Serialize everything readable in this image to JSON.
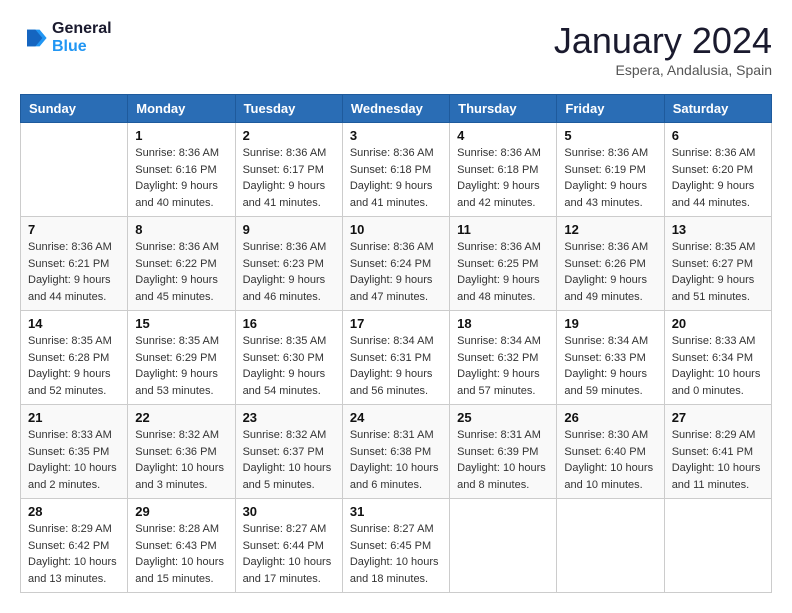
{
  "header": {
    "logo_line1": "General",
    "logo_line2": "Blue",
    "main_title": "January 2024",
    "subtitle": "Espera, Andalusia, Spain"
  },
  "days_of_week": [
    "Sunday",
    "Monday",
    "Tuesday",
    "Wednesday",
    "Thursday",
    "Friday",
    "Saturday"
  ],
  "weeks": [
    [
      {
        "day": "",
        "sunrise": "",
        "sunset": "",
        "daylight": ""
      },
      {
        "day": "1",
        "sunrise": "Sunrise: 8:36 AM",
        "sunset": "Sunset: 6:16 PM",
        "daylight": "Daylight: 9 hours and 40 minutes."
      },
      {
        "day": "2",
        "sunrise": "Sunrise: 8:36 AM",
        "sunset": "Sunset: 6:17 PM",
        "daylight": "Daylight: 9 hours and 41 minutes."
      },
      {
        "day": "3",
        "sunrise": "Sunrise: 8:36 AM",
        "sunset": "Sunset: 6:18 PM",
        "daylight": "Daylight: 9 hours and 41 minutes."
      },
      {
        "day": "4",
        "sunrise": "Sunrise: 8:36 AM",
        "sunset": "Sunset: 6:18 PM",
        "daylight": "Daylight: 9 hours and 42 minutes."
      },
      {
        "day": "5",
        "sunrise": "Sunrise: 8:36 AM",
        "sunset": "Sunset: 6:19 PM",
        "daylight": "Daylight: 9 hours and 43 minutes."
      },
      {
        "day": "6",
        "sunrise": "Sunrise: 8:36 AM",
        "sunset": "Sunset: 6:20 PM",
        "daylight": "Daylight: 9 hours and 44 minutes."
      }
    ],
    [
      {
        "day": "7",
        "sunrise": "Sunrise: 8:36 AM",
        "sunset": "Sunset: 6:21 PM",
        "daylight": "Daylight: 9 hours and 44 minutes."
      },
      {
        "day": "8",
        "sunrise": "Sunrise: 8:36 AM",
        "sunset": "Sunset: 6:22 PM",
        "daylight": "Daylight: 9 hours and 45 minutes."
      },
      {
        "day": "9",
        "sunrise": "Sunrise: 8:36 AM",
        "sunset": "Sunset: 6:23 PM",
        "daylight": "Daylight: 9 hours and 46 minutes."
      },
      {
        "day": "10",
        "sunrise": "Sunrise: 8:36 AM",
        "sunset": "Sunset: 6:24 PM",
        "daylight": "Daylight: 9 hours and 47 minutes."
      },
      {
        "day": "11",
        "sunrise": "Sunrise: 8:36 AM",
        "sunset": "Sunset: 6:25 PM",
        "daylight": "Daylight: 9 hours and 48 minutes."
      },
      {
        "day": "12",
        "sunrise": "Sunrise: 8:36 AM",
        "sunset": "Sunset: 6:26 PM",
        "daylight": "Daylight: 9 hours and 49 minutes."
      },
      {
        "day": "13",
        "sunrise": "Sunrise: 8:35 AM",
        "sunset": "Sunset: 6:27 PM",
        "daylight": "Daylight: 9 hours and 51 minutes."
      }
    ],
    [
      {
        "day": "14",
        "sunrise": "Sunrise: 8:35 AM",
        "sunset": "Sunset: 6:28 PM",
        "daylight": "Daylight: 9 hours and 52 minutes."
      },
      {
        "day": "15",
        "sunrise": "Sunrise: 8:35 AM",
        "sunset": "Sunset: 6:29 PM",
        "daylight": "Daylight: 9 hours and 53 minutes."
      },
      {
        "day": "16",
        "sunrise": "Sunrise: 8:35 AM",
        "sunset": "Sunset: 6:30 PM",
        "daylight": "Daylight: 9 hours and 54 minutes."
      },
      {
        "day": "17",
        "sunrise": "Sunrise: 8:34 AM",
        "sunset": "Sunset: 6:31 PM",
        "daylight": "Daylight: 9 hours and 56 minutes."
      },
      {
        "day": "18",
        "sunrise": "Sunrise: 8:34 AM",
        "sunset": "Sunset: 6:32 PM",
        "daylight": "Daylight: 9 hours and 57 minutes."
      },
      {
        "day": "19",
        "sunrise": "Sunrise: 8:34 AM",
        "sunset": "Sunset: 6:33 PM",
        "daylight": "Daylight: 9 hours and 59 minutes."
      },
      {
        "day": "20",
        "sunrise": "Sunrise: 8:33 AM",
        "sunset": "Sunset: 6:34 PM",
        "daylight": "Daylight: 10 hours and 0 minutes."
      }
    ],
    [
      {
        "day": "21",
        "sunrise": "Sunrise: 8:33 AM",
        "sunset": "Sunset: 6:35 PM",
        "daylight": "Daylight: 10 hours and 2 minutes."
      },
      {
        "day": "22",
        "sunrise": "Sunrise: 8:32 AM",
        "sunset": "Sunset: 6:36 PM",
        "daylight": "Daylight: 10 hours and 3 minutes."
      },
      {
        "day": "23",
        "sunrise": "Sunrise: 8:32 AM",
        "sunset": "Sunset: 6:37 PM",
        "daylight": "Daylight: 10 hours and 5 minutes."
      },
      {
        "day": "24",
        "sunrise": "Sunrise: 8:31 AM",
        "sunset": "Sunset: 6:38 PM",
        "daylight": "Daylight: 10 hours and 6 minutes."
      },
      {
        "day": "25",
        "sunrise": "Sunrise: 8:31 AM",
        "sunset": "Sunset: 6:39 PM",
        "daylight": "Daylight: 10 hours and 8 minutes."
      },
      {
        "day": "26",
        "sunrise": "Sunrise: 8:30 AM",
        "sunset": "Sunset: 6:40 PM",
        "daylight": "Daylight: 10 hours and 10 minutes."
      },
      {
        "day": "27",
        "sunrise": "Sunrise: 8:29 AM",
        "sunset": "Sunset: 6:41 PM",
        "daylight": "Daylight: 10 hours and 11 minutes."
      }
    ],
    [
      {
        "day": "28",
        "sunrise": "Sunrise: 8:29 AM",
        "sunset": "Sunset: 6:42 PM",
        "daylight": "Daylight: 10 hours and 13 minutes."
      },
      {
        "day": "29",
        "sunrise": "Sunrise: 8:28 AM",
        "sunset": "Sunset: 6:43 PM",
        "daylight": "Daylight: 10 hours and 15 minutes."
      },
      {
        "day": "30",
        "sunrise": "Sunrise: 8:27 AM",
        "sunset": "Sunset: 6:44 PM",
        "daylight": "Daylight: 10 hours and 17 minutes."
      },
      {
        "day": "31",
        "sunrise": "Sunrise: 8:27 AM",
        "sunset": "Sunset: 6:45 PM",
        "daylight": "Daylight: 10 hours and 18 minutes."
      },
      {
        "day": "",
        "sunrise": "",
        "sunset": "",
        "daylight": ""
      },
      {
        "day": "",
        "sunrise": "",
        "sunset": "",
        "daylight": ""
      },
      {
        "day": "",
        "sunrise": "",
        "sunset": "",
        "daylight": ""
      }
    ]
  ]
}
